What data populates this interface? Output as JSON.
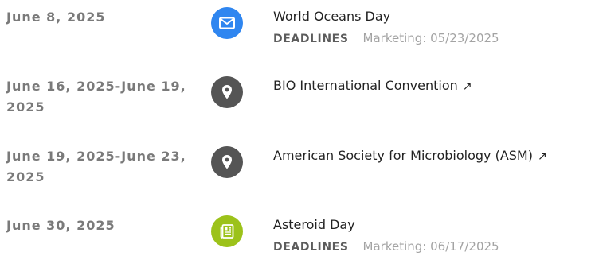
{
  "events": [
    {
      "date": "June 8, 2025",
      "icon": "envelope-icon",
      "icon_color": "#2f86f0",
      "title": "World Oceans Day",
      "meta_type": "DEADLINES",
      "meta_detail": "Marketing: 05/23/2025"
    },
    {
      "date": "June 16, 2025-June 19, 2025",
      "icon": "location-pin-icon",
      "icon_color": "#555555",
      "title": "BIO International Convention",
      "external_link_glyph": "↗"
    },
    {
      "date": "June 19, 2025-June 23, 2025",
      "icon": "location-pin-icon",
      "icon_color": "#555555",
      "title": "American Society for Microbiology (ASM)",
      "external_link_glyph": "↗"
    },
    {
      "date": "June 30, 2025",
      "icon": "newspaper-icon",
      "icon_color": "#9cc21a",
      "title": "Asteroid Day",
      "meta_type": "DEADLINES",
      "meta_detail": "Marketing: 06/17/2025"
    }
  ]
}
